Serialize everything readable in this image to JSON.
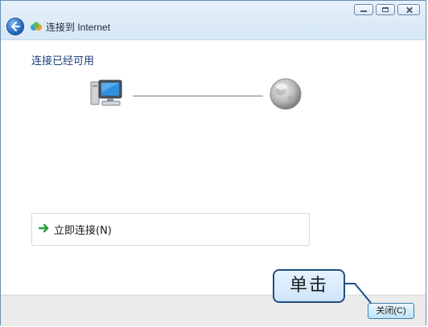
{
  "window": {
    "title": "连接到 Internet",
    "controls": [
      "minimize",
      "maximize",
      "close"
    ]
  },
  "content": {
    "heading": "连接已经可用",
    "source_icon": "computer-icon",
    "target_icon": "globe-icon",
    "connect_option": {
      "label": "立即连接(N)",
      "icon": "green-arrow-icon"
    }
  },
  "footer": {
    "close_button": "关闭(C)"
  },
  "annotation": {
    "callout_text": "单击"
  }
}
